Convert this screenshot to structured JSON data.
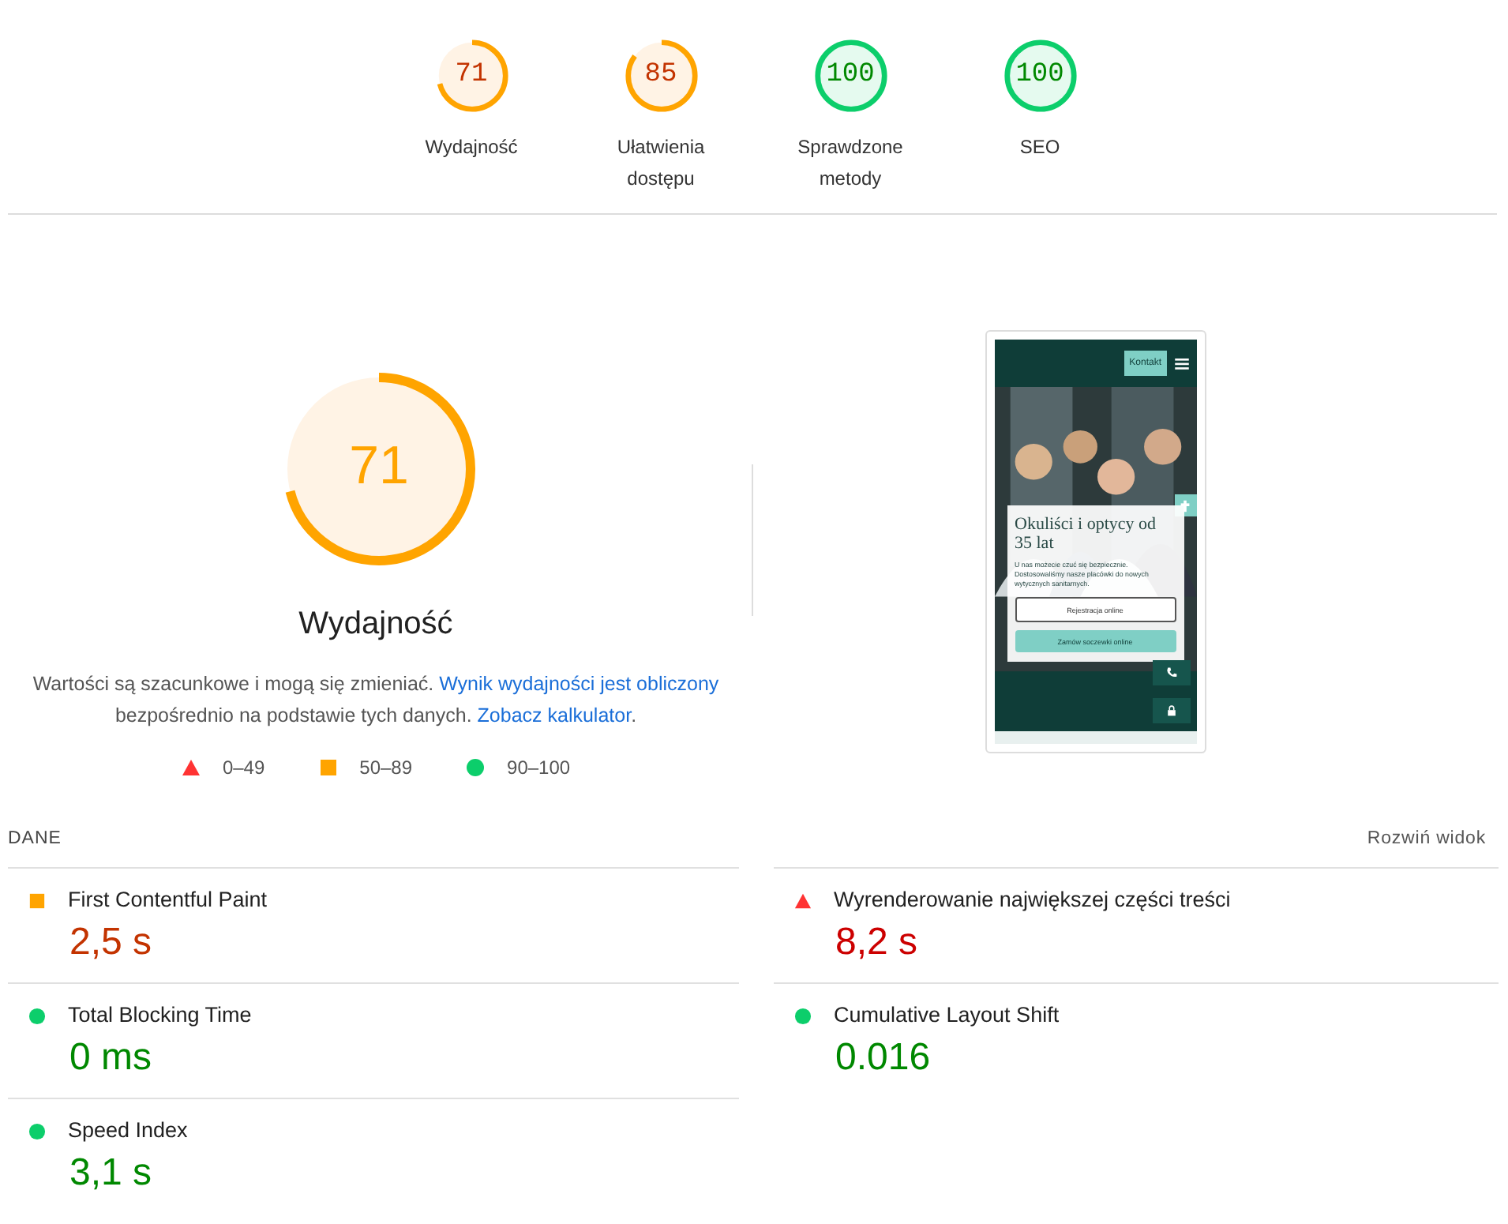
{
  "categories": [
    {
      "score": "71",
      "label": "Wydajność",
      "color": "#ffa400"
    },
    {
      "score": "85",
      "label": "Ułatwienia dostępu",
      "color": "#ffa400"
    },
    {
      "score": "100",
      "label": "Sprawdzone metody",
      "color": "#0cce6b"
    },
    {
      "score": "100",
      "label": "SEO",
      "color": "#0cce6b"
    }
  ],
  "main_gauge": {
    "score": "71",
    "title": "Wydajność",
    "color": "#ffa400"
  },
  "description": [
    {
      "kind": "text",
      "text": "Wartości są szacunkowe i mogą się zmieniać. "
    },
    {
      "kind": "link",
      "text": "Wynik wydajności jest obliczony"
    },
    {
      "kind": "text",
      "text": " bezpośrednio na podstawie tych danych. "
    },
    {
      "kind": "link",
      "text": "Zobacz kalkulator"
    },
    {
      "kind": "text",
      "text": "."
    }
  ],
  "legend": [
    {
      "kind": "triangle",
      "range": "0–49"
    },
    {
      "kind": "square",
      "range": "50–89"
    },
    {
      "kind": "circle",
      "range": "90–100"
    }
  ],
  "thumbnail": {
    "contact_button": "Kontakt",
    "heading": "Okuliści i optycy od 35 lat",
    "text": "U nas możecie czuć się bezpiecznie. Dostosowaliśmy nasze placówki do nowych wytycznych sanitarnych.",
    "buttons": [
      "Rejestracja online",
      "Zamów soczewki online"
    ]
  },
  "metrics_header": {
    "title": "DANE",
    "toggle": "Rozwiń widok"
  },
  "metrics": [
    {
      "name": "First Contentful Paint",
      "value": "2,5 s",
      "kind": "square"
    },
    {
      "name": "Wyrenderowanie największej części treści",
      "value": "8,2 s",
      "kind": "triangle"
    },
    {
      "name": "Total Blocking Time",
      "value": "0 ms",
      "kind": "circle"
    },
    {
      "name": "Cumulative Layout Shift",
      "value": "0.016",
      "kind": "circle"
    },
    {
      "name": "Speed Index",
      "value": "3,1 s",
      "kind": "circle"
    }
  ]
}
